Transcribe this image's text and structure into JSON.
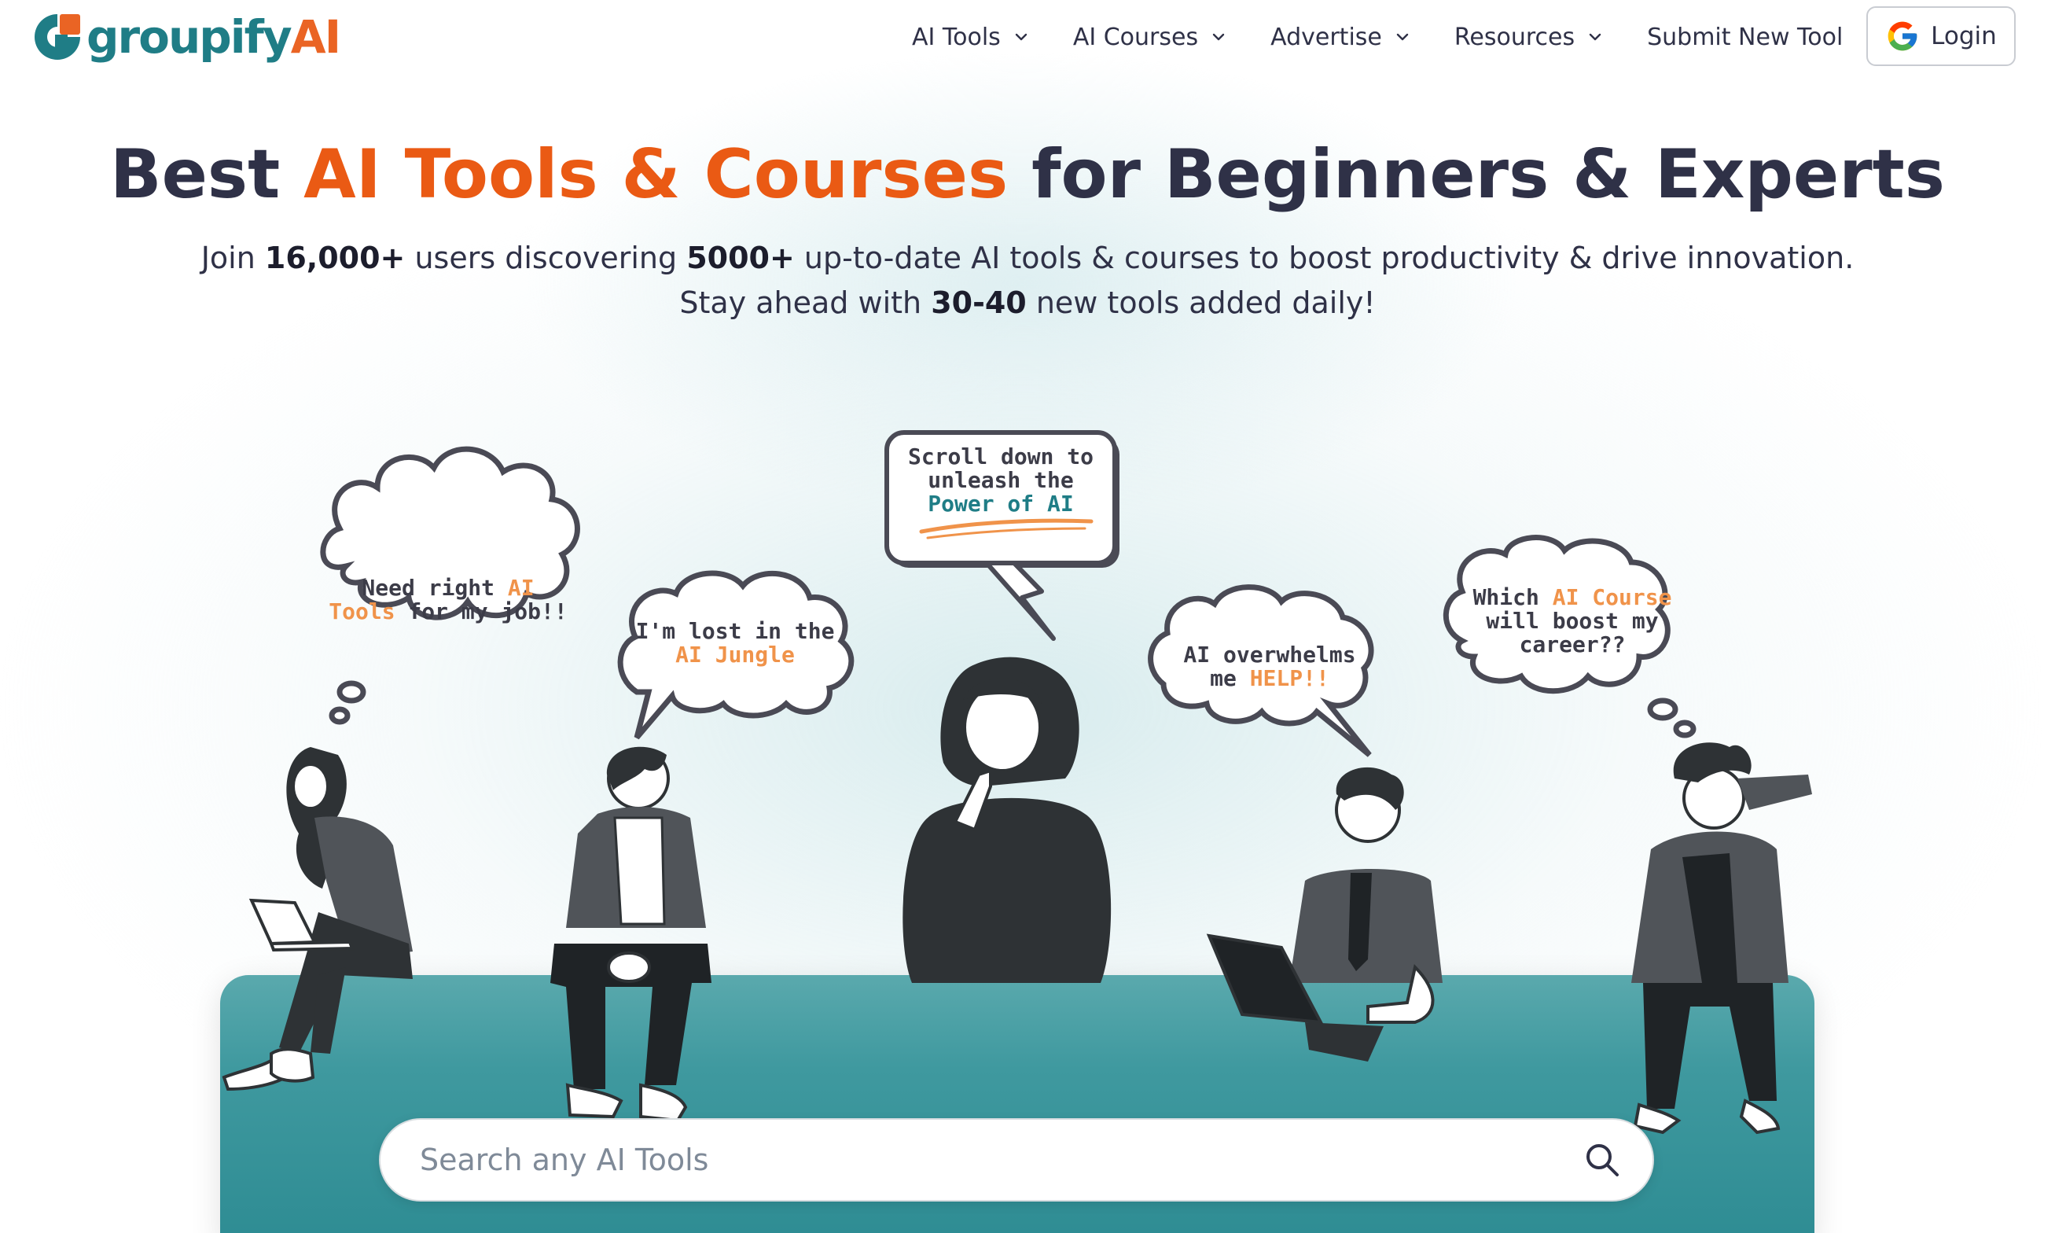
{
  "brand": {
    "name_part1": "groupify",
    "name_part2": "AI",
    "colors": {
      "teal": "#1f7d86",
      "orange": "#ea6424"
    }
  },
  "nav": {
    "items": [
      {
        "label": "AI Tools",
        "has_dropdown": true,
        "icon": "chevron-down-icon"
      },
      {
        "label": "AI Courses",
        "has_dropdown": true,
        "icon": "chevron-down-icon"
      },
      {
        "label": "Advertise",
        "has_dropdown": true,
        "icon": "chevron-down-icon"
      },
      {
        "label": "Resources",
        "has_dropdown": true,
        "icon": "chevron-down-icon"
      },
      {
        "label": "Submit New Tool",
        "has_dropdown": false
      }
    ],
    "login_label": "Login",
    "login_icon": "google-icon"
  },
  "hero": {
    "title_prefix": "Best ",
    "title_accent": "AI Tools & Courses",
    "title_suffix": " for Beginners & Experts",
    "sub_line1_a": "Join ",
    "sub_line1_users": "16,000+",
    "sub_line1_b": " users discovering ",
    "sub_line1_count": "5000+",
    "sub_line1_c": " up-to-date AI tools & courses to boost productivity & drive innovation.",
    "sub_line2_a": "Stay ahead with ",
    "sub_line2_count": "30-40",
    "sub_line2_b": " new tools added daily!",
    "accent_color": "#ea5a14"
  },
  "bubbles": {
    "b1": {
      "l1a": "Need right ",
      "l1b": "AI",
      "l2a": "Tools",
      "l2b": " for my job!!"
    },
    "b2": {
      "l1": "I'm lost in the",
      "l2": "AI Jungle"
    },
    "b3": {
      "l1": "Scroll down to",
      "l2": "unleash the",
      "l3": "Power of AI"
    },
    "b4": {
      "l1": "AI overwhelms",
      "l2a": "me ",
      "l2b": "HELP!!"
    },
    "b5": {
      "l1a": "Which ",
      "l1b": "AI Course",
      "l2": "will boost my",
      "l3": "career??"
    }
  },
  "search": {
    "placeholder": "Search any AI Tools",
    "icon": "search-icon"
  }
}
